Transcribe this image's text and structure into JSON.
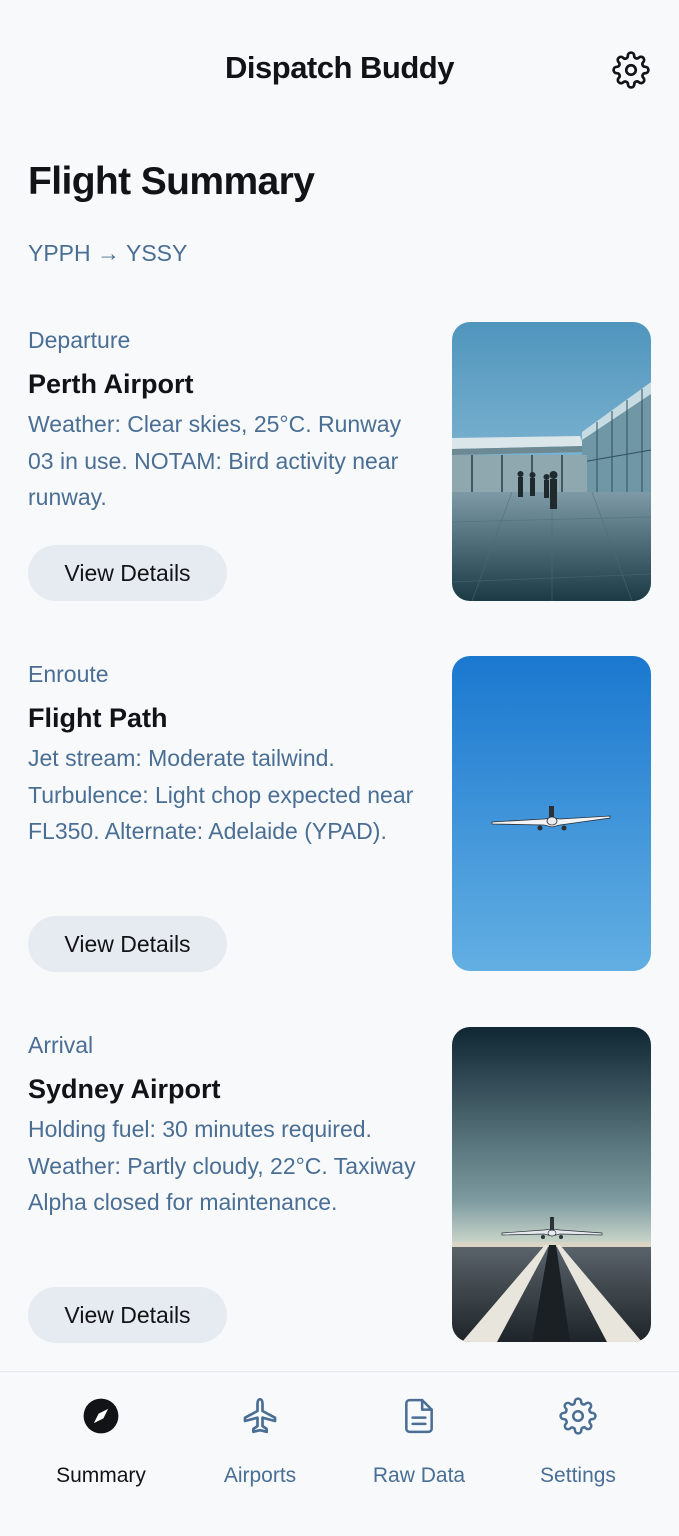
{
  "header": {
    "app_title": "Dispatch Buddy",
    "settings_icon": "gear-icon"
  },
  "summary": {
    "title": "Flight Summary",
    "route": "YPPH → YSSY"
  },
  "cards": [
    {
      "eyebrow": "Departure",
      "title": "Perth Airport",
      "description": "Weather: Clear skies, 25°C. Runway 03 in use. NOTAM: Bird activity near runway.",
      "button": "View Details",
      "image": "airport-terminal-photo"
    },
    {
      "eyebrow": "Enroute",
      "title": "Flight Path",
      "description": "Jet stream: Moderate tailwind. Turbulence: Light chop expected near FL350. Alternate: Adelaide (YPAD).",
      "button": "View Details",
      "image": "airplane-in-sky-photo"
    },
    {
      "eyebrow": "Arrival",
      "title": "Sydney Airport",
      "description": "Holding fuel: 30 minutes required. Weather: Partly cloudy, 22°C. Taxiway Alpha closed for maintenance.",
      "button": "View Details",
      "image": "runway-airplane-photo"
    }
  ],
  "bottom_nav": {
    "active": "Summary",
    "items": [
      {
        "label": "Summary",
        "icon": "compass-icon"
      },
      {
        "label": "Airports",
        "icon": "plane-icon"
      },
      {
        "label": "Raw Data",
        "icon": "document-icon"
      },
      {
        "label": "Settings",
        "icon": "gear-icon"
      }
    ]
  },
  "colors": {
    "background": "#f7f9fb",
    "text_primary": "#121317",
    "text_secondary": "#4a6e94",
    "button_bg": "#e6ebf1"
  }
}
